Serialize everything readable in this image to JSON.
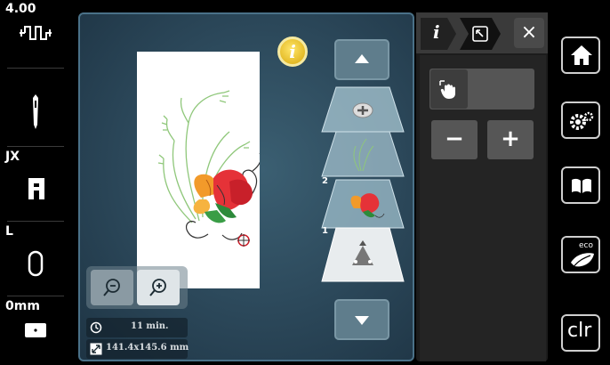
{
  "status_bar": {
    "stitch_width": "4.00",
    "presser_foot": "JX",
    "hoop": "L",
    "needle_position": "0mm"
  },
  "embroidery": {
    "info_button_label": "i",
    "layers": [
      {
        "number": "",
        "kind": "add"
      },
      {
        "number": "2",
        "kind": "grass-design"
      },
      {
        "number": "1",
        "kind": "flower-design"
      },
      {
        "number": "",
        "kind": "fabric"
      }
    ],
    "stitch_time": "11 min.",
    "design_size": "141.4x145.6 mm"
  },
  "function_panel": {
    "tab_info_label": "i",
    "close_label": "×",
    "minus_label": "−",
    "plus_label": "+"
  },
  "nav": {
    "eco_label": "eco",
    "clr_label": "clr"
  },
  "colors": {
    "accent_yellow": "#e8c21a",
    "panel_dark": "#242424",
    "canvas_blue": "#2b4759"
  }
}
